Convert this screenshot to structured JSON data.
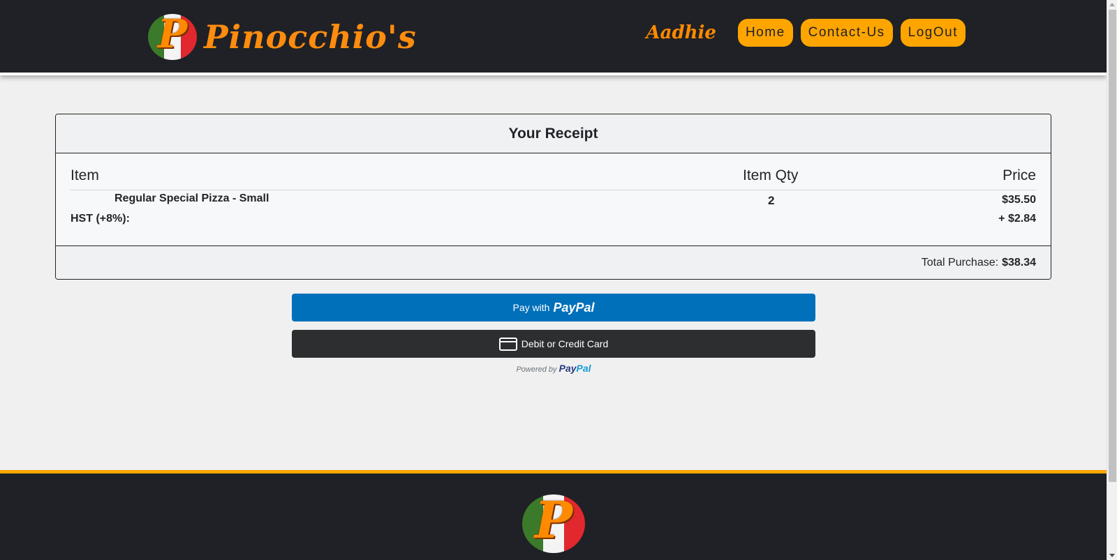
{
  "header": {
    "brand_name": "Pinocchio's",
    "logo_letter": "P",
    "user_name": "Aadhie",
    "nav": [
      {
        "label": "Home"
      },
      {
        "label": "Contact-Us"
      },
      {
        "label": "LogOut"
      }
    ]
  },
  "receipt": {
    "title": "Your Receipt",
    "columns": {
      "item": "Item",
      "qty": "Item Qty",
      "price": "Price"
    },
    "items": [
      {
        "name": "Regular Special Pizza - Small",
        "qty": "2",
        "price": "$35.50"
      }
    ],
    "tax": {
      "label": "HST (+8%):",
      "value": "+ $2.84"
    },
    "total_label": "Total Purchase:",
    "total_value": "$38.34"
  },
  "paypal": {
    "pay_prefix": "Pay with",
    "pay_brand": "PayPal",
    "card_label": "Debit or Credit Card",
    "powered_prefix": "Powered by",
    "powered_brand_1": "Pay",
    "powered_brand_2": "Pal"
  },
  "footer": {
    "logo_letter": "P"
  },
  "colors": {
    "header_bg": "#1f2126",
    "accent_orange": "#ffa500",
    "brand_orange": "#ff8c0f",
    "paypal_blue": "#0070ba",
    "card_button_dark": "#2c2e2f"
  }
}
